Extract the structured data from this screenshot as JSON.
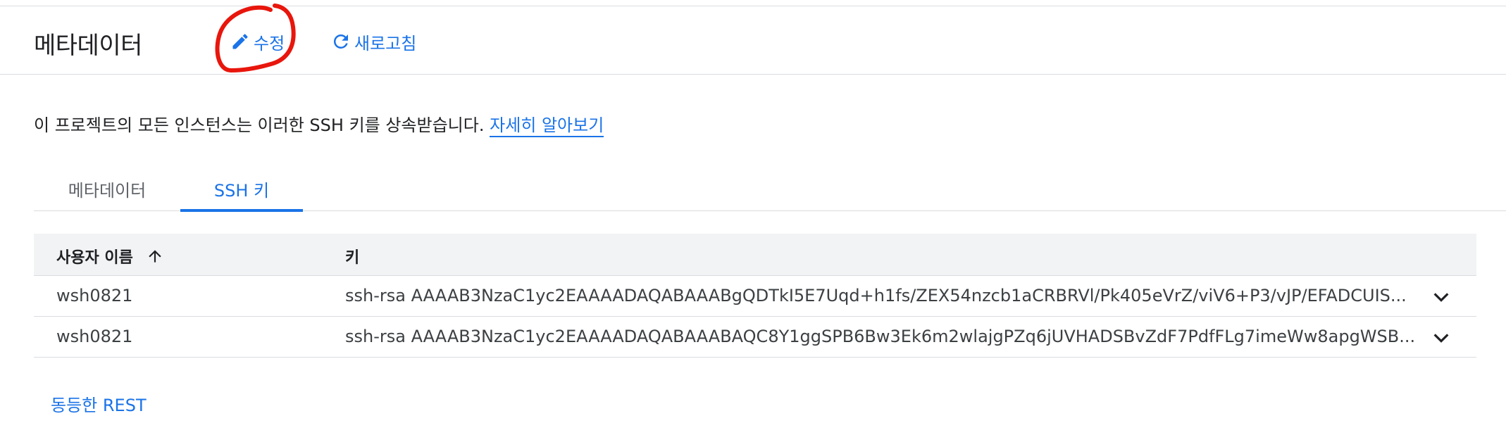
{
  "header": {
    "title": "메타데이터",
    "edit_label": "수정",
    "refresh_label": "새로고침"
  },
  "info": {
    "text": "이 프로젝트의 모든 인스턴스는 이러한 SSH 키를 상속받습니다.",
    "link": "자세히 알아보기"
  },
  "tabs": [
    {
      "label": "메타데이터",
      "active": false
    },
    {
      "label": "SSH 키",
      "active": true
    }
  ],
  "table": {
    "columns": [
      "사용자 이름",
      "키"
    ],
    "sort": "ascending",
    "rows": [
      {
        "user": "wsh0821",
        "key": "ssh-rsa AAAAB3NzaC1yc2EAAAADAQABAAABgQDTkI5E7Uqd+h1fs/ZEX54nzcb1aCRBRVl/Pk405eVrZ/viV6+P3/vJP/EFADCUIS..."
      },
      {
        "user": "wsh0821",
        "key": "ssh-rsa AAAAB3NzaC1yc2EAAAADAQABAAABAQC8Y1ggSPB6Bw3Ek6m2wlajgPZq6jUVHADSBvZdF7PdfFLg7imeWw8apgWSB..."
      }
    ]
  },
  "footer": {
    "rest_label": "동등한 REST"
  },
  "icons": {
    "edit": "pencil-icon",
    "refresh": "refresh-icon",
    "sort": "arrow-up-icon",
    "expand": "chevron-down-icon"
  },
  "colors": {
    "accent": "#1a73e8",
    "annotation": "#e8160c",
    "header_bg": "#f1f3f4",
    "divider": "#dadce0"
  }
}
